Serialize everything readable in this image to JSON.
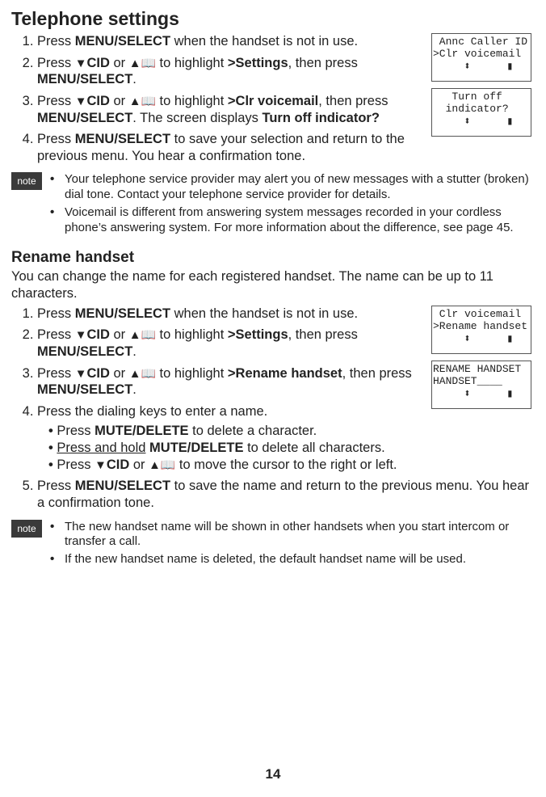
{
  "page_number": "14",
  "section1": {
    "title": "Telephone settings",
    "steps": [
      {
        "pre": "Press ",
        "bold1": "MENU/",
        "smallcap1": "SELECT",
        "post": " when the handset is not in use."
      },
      {
        "html": "Press ▼CID or ▲📖 to highlight >Settings, then press MENU/SELECT.",
        "parts": {
          "p1": "Press ",
          "icon1": "▼",
          "cid1": "CID",
          "p2": " or ",
          "icon2": "▲",
          "book": "📖",
          "p3": " to highlight ",
          "bold1": ">Settings",
          "p4": ", then press ",
          "small1": "MENU",
          "bold2": "/SELECT",
          "p5": "."
        }
      },
      {
        "parts": {
          "p1": "Press ",
          "icon1": "▼",
          "cid1": "CID",
          "p2": " or ",
          "icon2": "▲",
          "book": "📖",
          "p3": " to highlight ",
          "bold1": ">Clr voicemail",
          "p4": ", then press ",
          "small1": "MENU",
          "bold2": "/SELECT",
          "p5": ". The screen displays ",
          "bold3": "Turn off indicator?"
        }
      },
      {
        "parts": {
          "p1": "Press ",
          "small1": "MENU",
          "bold1": "/SELECT",
          "p2": " to save your selection and return to the previous menu. You hear a confirmation tone."
        }
      }
    ],
    "screens": [
      {
        "l1": " Annc Caller ID",
        "l2": ">Clr voicemail"
      },
      {
        "l1": "   Turn off",
        "l2": "  indicator?"
      }
    ],
    "note": {
      "label": "note",
      "items": [
        "Your telephone service provider may alert you of new messages with a stutter (broken) dial tone. Contact your telephone service provider for details.",
        "Voicemail is different from answering system messages recorded in your cordless phone’s answering system. For more information about the difference, see page 45."
      ]
    }
  },
  "section2": {
    "title": "Rename handset",
    "intro": "You can change the name for each registered handset. The name can be up to 11 characters.",
    "steps_text": {
      "s1": {
        "p1": "Press ",
        "bold1": "MENU/",
        "sc1": "SELECT",
        "p2": " when the handset is not in use."
      },
      "s2": {
        "p1": "Press ",
        "icon1": "▼",
        "cid1": "CID",
        "p2": " or ",
        "icon2": "▲",
        "book": "📖",
        "p3": " to highlight ",
        "bold1": ">Settings",
        "p4": ", then press ",
        "small1": "MENU",
        "bold2": "/SELECT",
        "p5": "."
      },
      "s3": {
        "p1": "Press ",
        "icon1": "▼",
        "cid1": "CID",
        "p2": " or ",
        "icon2": "▲",
        "book": "📖",
        "p3": " to highlight ",
        "bold1": ">Rename handset",
        "p4": ", then press ",
        "small1": "MENU",
        "bold2": "/SELECT",
        "p5": "."
      },
      "s4": "Press the dialing keys to enter a name.",
      "sub1": {
        "p1": "Press ",
        "small1": "MUTE",
        "bold1": "/DELETE",
        "p2": " to delete a character."
      },
      "sub2": {
        "u1": "Press and hold",
        "p1": " ",
        "small1": "MUTE",
        "bold1": "/DELETE",
        "p2": " to delete all characters."
      },
      "sub3": {
        "p1": "Press ",
        "icon1": "▼",
        "cid1": "CID",
        "p2": " or ",
        "icon2": "▲",
        "book": "📖",
        "p3": " to move the cursor to the right or left."
      },
      "s5": {
        "p1": "Press ",
        "small1": "MENU",
        "bold1": "/SELECT",
        "p2": " to save the name and return to the previous menu. You hear a confirmation tone."
      }
    },
    "screens": [
      {
        "l1": " Clr voicemail",
        "l2": ">Rename handset"
      },
      {
        "l1": "RENAME HANDSET",
        "l2": "HANDSET____"
      }
    ],
    "note": {
      "label": "note",
      "items": [
        "The new handset name will be shown in other handsets when you start intercom or transfer a call.",
        "If the new handset name is deleted, the default handset name will be used."
      ]
    }
  }
}
